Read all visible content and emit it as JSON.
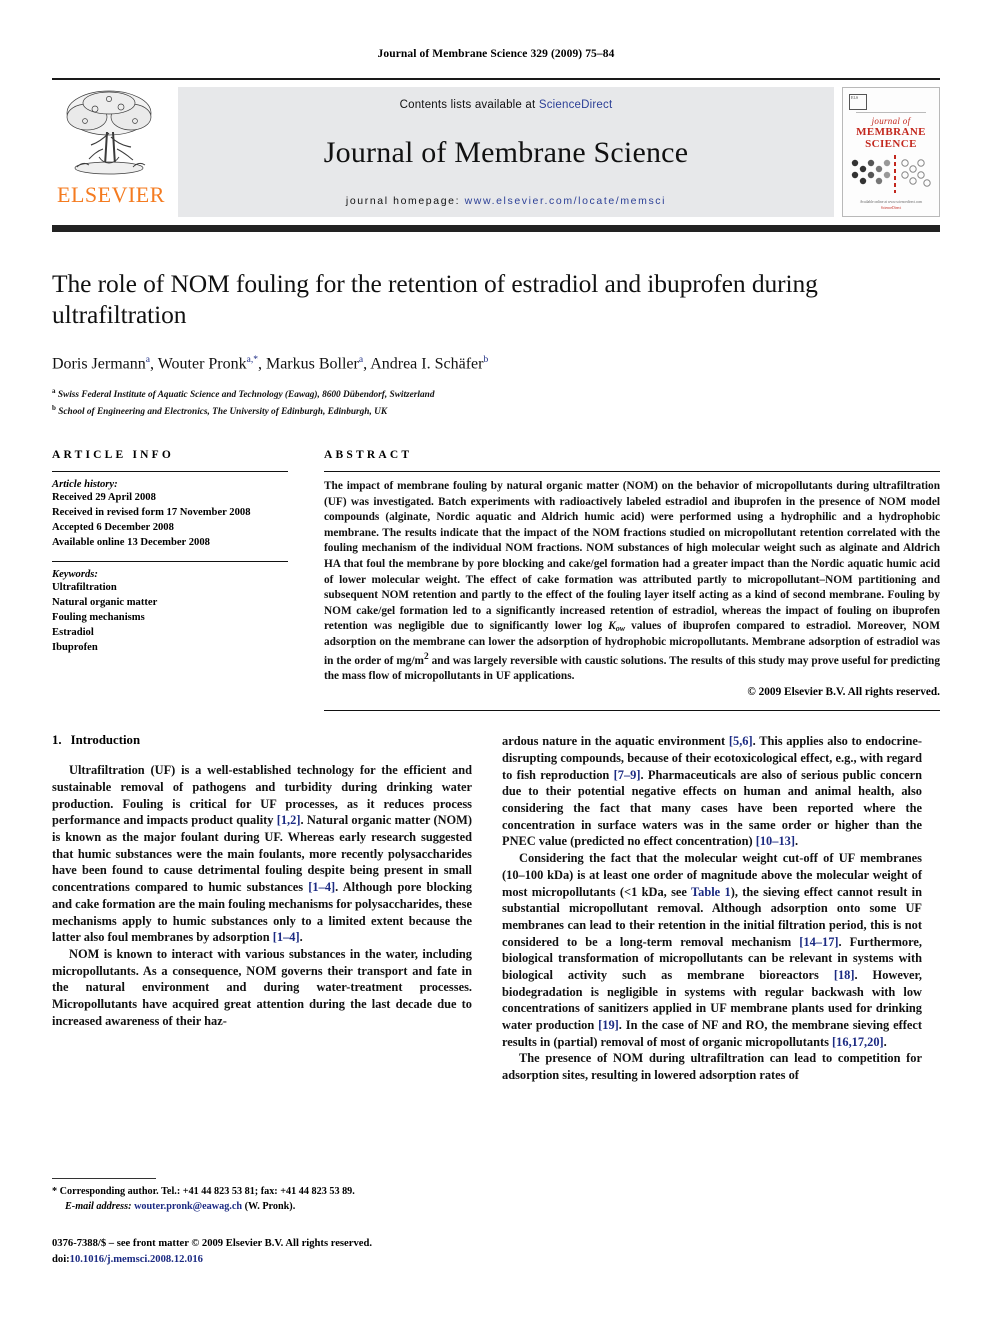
{
  "running_head": "Journal of Membrane Science 329 (2009) 75–84",
  "masthead": {
    "publisher_name": "ELSEVIER",
    "contents_prefix": "Contents lists available at",
    "sciencedirect": "ScienceDirect",
    "journal_title": "Journal of Membrane Science",
    "homepage_prefix": "journal homepage:",
    "homepage_url": "www.elsevier.com/locate/memsci",
    "cover": {
      "line1": "journal of",
      "line2": "MEMBRANE",
      "line3": "SCIENCE",
      "footer1": "Available online at www.sciencedirect.com",
      "footer2": "ScienceDirect"
    }
  },
  "article": {
    "title": "The role of NOM fouling for the retention of estradiol and ibuprofen during ultrafiltration",
    "authors": "Doris Jermann, Wouter Pronk, Markus Boller, Andrea I. Schäfer",
    "author_list": [
      {
        "name": "Doris Jermann",
        "sup": "a"
      },
      {
        "name": "Wouter Pronk",
        "sup": "a,*"
      },
      {
        "name": "Markus Boller",
        "sup": "a"
      },
      {
        "name": "Andrea I. Schäfer",
        "sup": "b"
      }
    ],
    "affiliations": [
      {
        "marker": "a",
        "text": "Swiss Federal Institute of Aquatic Science and Technology (Eawag), 8600 Dübendorf, Switzerland"
      },
      {
        "marker": "b",
        "text": "School of Engineering and Electronics, The University of Edinburgh, Edinburgh, UK"
      }
    ]
  },
  "article_info": {
    "heading": "ARTICLE INFO",
    "history_label": "Article history:",
    "history": [
      "Received 29 April 2008",
      "Received in revised form 17 November 2008",
      "Accepted 6 December 2008",
      "Available online 13 December 2008"
    ],
    "keywords_label": "Keywords:",
    "keywords": [
      "Ultrafiltration",
      "Natural organic matter",
      "Fouling mechanisms",
      "Estradiol",
      "Ibuprofen"
    ]
  },
  "abstract": {
    "heading": "ABSTRACT",
    "part1": "The impact of membrane fouling by natural organic matter (NOM) on the behavior of micropollutants during ultrafiltration (UF) was investigated. Batch experiments with radioactively labeled estradiol and ibuprofen in the presence of NOM model compounds (alginate, Nordic aquatic and Aldrich humic acid) were performed using a hydrophilic and a hydrophobic membrane. The results indicate that the impact of the NOM fractions studied on micropollutant retention correlated with the fouling mechanism of the individual NOM fractions. NOM substances of high molecular weight such as alginate and Aldrich HA that foul the membrane by pore blocking and cake/gel formation had a greater impact than the Nordic aquatic humic acid of lower molecular weight. The effect of cake formation was attributed partly to micropollutant–NOM partitioning and subsequent NOM retention and partly to the effect of the fouling layer itself acting as a kind of second membrane. Fouling by NOM cake/gel formation led to a significantly increased retention of estradiol, whereas the impact of fouling on ibuprofen retention was negligible due to significantly lower log ",
    "k_symbol": "K",
    "k_sub": "ow",
    "part2": " values of ibuprofen compared to estradiol. Moreover, NOM adsorption on the membrane can lower the adsorption of hydrophobic micropollutants. Membrane adsorption of estradiol was in the order of mg/m",
    "sup2": "2",
    "part3": " and was largely reversible with caustic solutions. The results of this study may prove useful for predicting the mass flow of micropollutants in UF applications.",
    "copyright": "© 2009 Elsevier B.V. All rights reserved."
  },
  "introduction": {
    "number": "1.",
    "heading": "Introduction",
    "left_paragraphs": [
      {
        "segments": [
          {
            "t": "Ultrafiltration (UF) is a well-established technology for the efficient and sustainable removal of pathogens and turbidity during drinking water production. Fouling is critical for UF processes, as it reduces process performance and impacts product quality "
          },
          {
            "t": "[1,2]",
            "ref": true
          },
          {
            "t": ". Natural organic matter (NOM) is known as the major foulant during UF. Whereas early research suggested that humic substances were the main foulants, more recently polysaccharides have been found to cause detrimental fouling despite being present in small concentrations compared to humic substances "
          },
          {
            "t": "[1–4]",
            "ref": true
          },
          {
            "t": ". Although pore blocking and cake formation are the main fouling mechanisms for polysaccharides, these mechanisms apply to humic substances only to a limited extent because the latter also foul membranes by adsorption "
          },
          {
            "t": "[1–4]",
            "ref": true
          },
          {
            "t": "."
          }
        ]
      },
      {
        "segments": [
          {
            "t": "NOM is known to interact with various substances in the water, including micropollutants. As a consequence, NOM governs their transport and fate in the natural environment and during water-treatment processes. Micropollutants have acquired great attention during the last decade due to increased awareness of their haz-"
          }
        ]
      }
    ],
    "right_paragraphs": [
      {
        "segments": [
          {
            "t": "ardous nature in the aquatic environment "
          },
          {
            "t": "[5,6]",
            "ref": true
          },
          {
            "t": ". This applies also to endocrine-disrupting compounds, because of their ecotoxicological effect, e.g., with regard to fish reproduction "
          },
          {
            "t": "[7–9]",
            "ref": true
          },
          {
            "t": ". Pharmaceuticals are also of serious public concern due to their potential negative effects on human and animal health, also considering the fact that many cases have been reported where the concentration in surface waters was in the same order or higher than the PNEC value (predicted no effect concentration) "
          },
          {
            "t": "[10–13]",
            "ref": true
          },
          {
            "t": "."
          }
        ],
        "noindent": true
      },
      {
        "segments": [
          {
            "t": "Considering the fact that the molecular weight cut-off of UF membranes (10–100 kDa) is at least one order of magnitude above the molecular weight of most micropollutants (<1 kDa, see "
          },
          {
            "t": "Table 1",
            "ref": true
          },
          {
            "t": "), the sieving effect cannot result in substantial micropollutant removal. Although adsorption onto some UF membranes can lead to their retention in the initial filtration period, this is not considered to be a long-term removal mechanism "
          },
          {
            "t": "[14–17]",
            "ref": true
          },
          {
            "t": ". Furthermore, biological transformation of micropollutants can be relevant in systems with biological activity such as membrane bioreactors "
          },
          {
            "t": "[18]",
            "ref": true
          },
          {
            "t": ". However, biodegradation is negligible in systems with regular backwash with low concentrations of sanitizers applied in UF membrane plants used for drinking water production "
          },
          {
            "t": "[19]",
            "ref": true
          },
          {
            "t": ". In the case of NF and RO, the membrane sieving effect results in (partial) removal of most of organic micropollutants "
          },
          {
            "t": "[16,17,20]",
            "ref": true
          },
          {
            "t": "."
          }
        ]
      },
      {
        "segments": [
          {
            "t": "The presence of NOM during ultrafiltration can lead to competition for adsorption sites, resulting in lowered adsorption rates of"
          }
        ]
      }
    ]
  },
  "footnotes": {
    "corresponding_marker": "*",
    "corresponding_text": "Corresponding author. Tel.: +41 44 823 53 81; fax: +41 44 823 53 89.",
    "email_label": "E-mail address:",
    "email": "wouter.pronk@eawag.ch",
    "email_owner": "(W. Pronk)."
  },
  "front_matter": {
    "line1": "0376-7388/$ – see front matter © 2009 Elsevier B.V. All rights reserved.",
    "doi_label": "doi:",
    "doi": "10.1016/j.memsci.2008.12.016"
  },
  "colors": {
    "link": "#1b2a82",
    "elsevier_orange": "#F47B20",
    "cover_red": "#c3281e",
    "band_grey": "#e7e8ea"
  }
}
